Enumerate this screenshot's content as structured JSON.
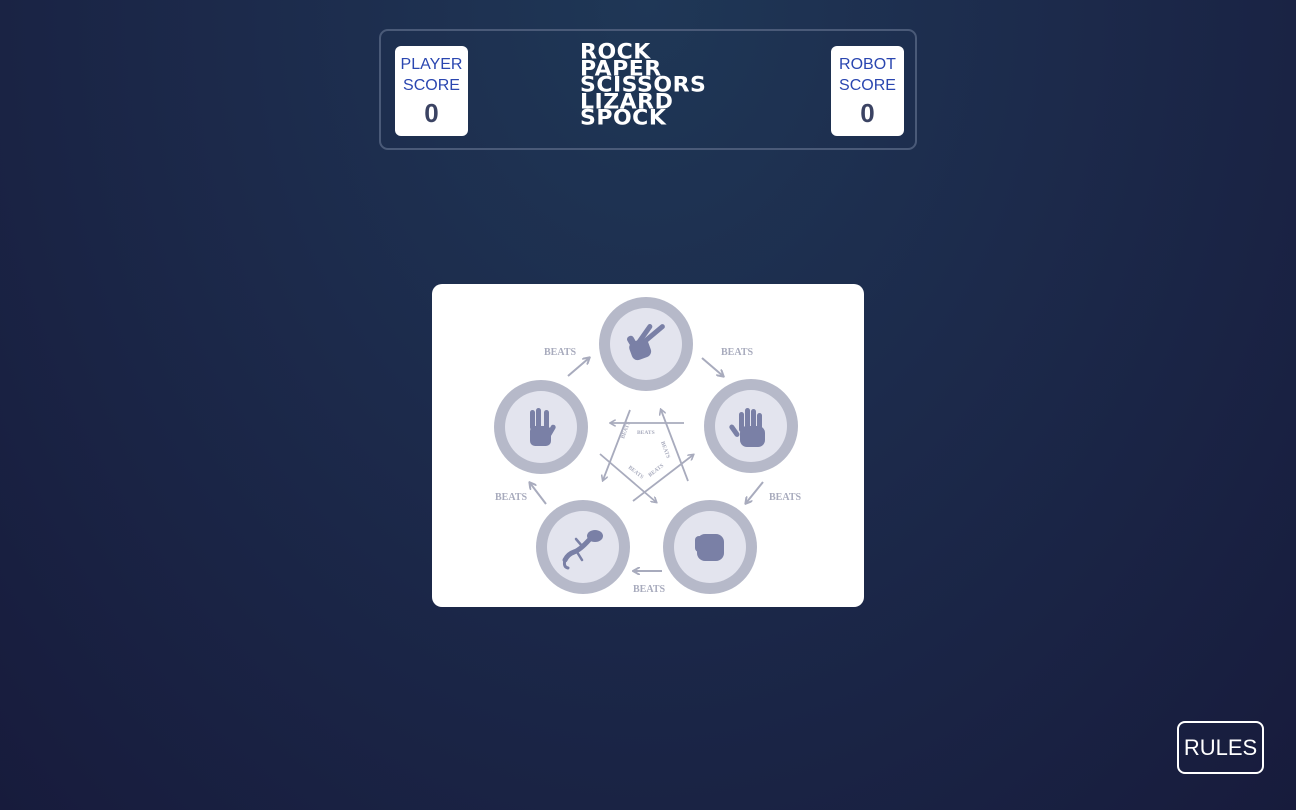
{
  "header": {
    "player_score": {
      "label_line1": "PLAYER",
      "label_line2": "SCORE",
      "value": "0"
    },
    "robot_score": {
      "label_line1": "ROBOT",
      "label_line2": "SCORE",
      "value": "0"
    },
    "logo_lines": [
      "ROCK",
      "PAPER",
      "SCISSORS",
      "LIZARD",
      "SPOCK"
    ]
  },
  "rules_diagram": {
    "beats_label": "BEATS",
    "moves": [
      {
        "name": "scissors",
        "icon": "scissors-hand-icon"
      },
      {
        "name": "paper",
        "icon": "open-hand-icon"
      },
      {
        "name": "rock",
        "icon": "fist-icon"
      },
      {
        "name": "lizard",
        "icon": "lizard-icon"
      },
      {
        "name": "spock",
        "icon": "vulcan-salute-icon"
      }
    ]
  },
  "footer": {
    "rules_button_label": "RULES"
  },
  "colors": {
    "background": "#1c2a4b",
    "score_label": "#2a46b0",
    "score_value": "#3b4363",
    "diagram_ring": "#b6b9c9",
    "diagram_inner": "#e3e4ee",
    "diagram_icon": "#7a80a6"
  }
}
